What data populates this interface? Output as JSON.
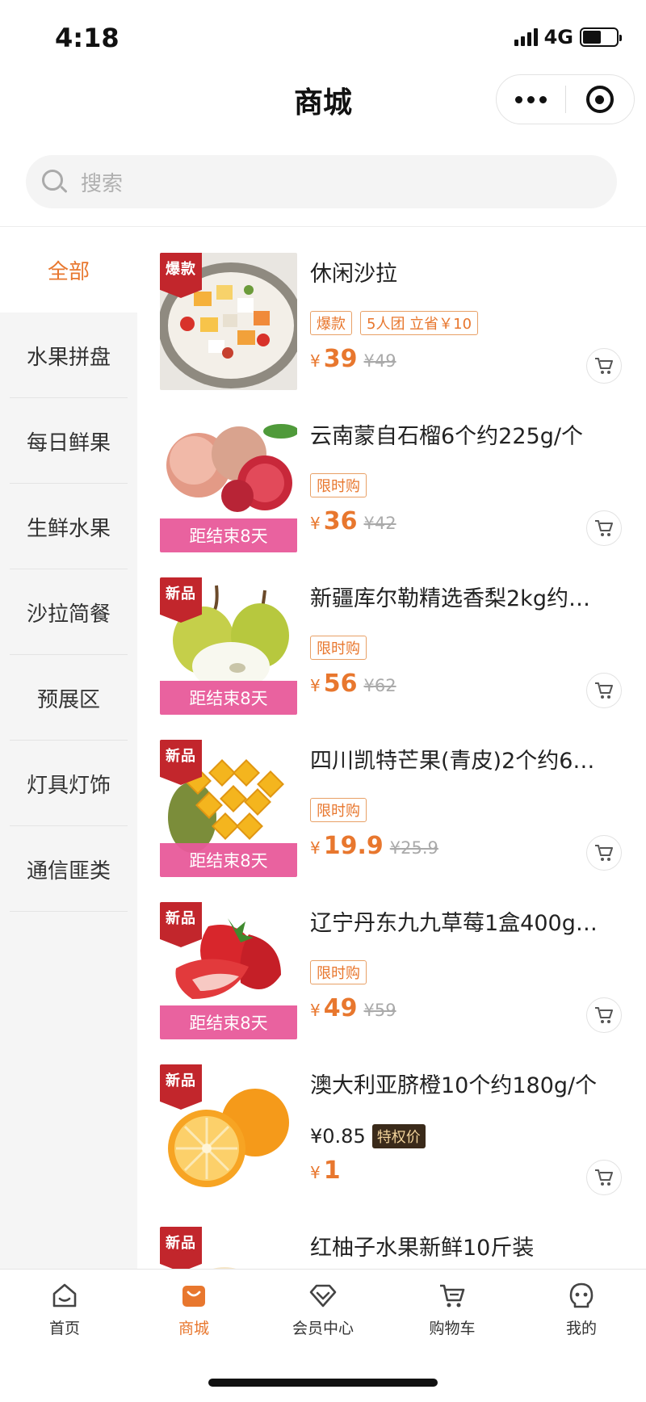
{
  "status_bar": {
    "time": "4:18",
    "network": "4G"
  },
  "header": {
    "title": "商城"
  },
  "search": {
    "placeholder": "搜索"
  },
  "sidebar": {
    "items": [
      {
        "label": "全部",
        "active": true
      },
      {
        "label": "水果拼盘"
      },
      {
        "label": "每日鲜果"
      },
      {
        "label": "生鲜水果"
      },
      {
        "label": "沙拉简餐"
      },
      {
        "label": "预展区"
      },
      {
        "label": "灯具灯饰"
      },
      {
        "label": "通信匪类"
      }
    ]
  },
  "products": [
    {
      "title": "休闲沙拉",
      "corner_tag": "爆款",
      "badges": [
        "爆款",
        "5人团 立省￥10"
      ],
      "yen": "¥",
      "price": "39",
      "original_price": "¥49"
    },
    {
      "title": "云南蒙自石榴6个约225g/个",
      "badges": [
        "限时购"
      ],
      "countdown": "距结束8天",
      "yen": "¥",
      "price": "36",
      "original_price": "¥42"
    },
    {
      "title": "新疆库尔勒精选香梨2kg约…",
      "corner_tag": "新品",
      "badges": [
        "限时购"
      ],
      "countdown": "距结束8天",
      "yen": "¥",
      "price": "56",
      "original_price": "¥62"
    },
    {
      "title": "四川凯特芒果(青皮)2个约6…",
      "corner_tag": "新品",
      "badges": [
        "限时购"
      ],
      "countdown": "距结束8天",
      "yen": "¥",
      "price": "19.9",
      "original_price": "¥25.9"
    },
    {
      "title": "辽宁丹东九九草莓1盒400g…",
      "corner_tag": "新品",
      "badges": [
        "限时购"
      ],
      "countdown": "距结束8天",
      "yen": "¥",
      "price": "49",
      "original_price": "¥59"
    },
    {
      "title": "澳大利亚脐橙10个约180g/个",
      "corner_tag": "新品",
      "vip_price": "¥0.85",
      "vip_tag": "特权价",
      "yen": "¥",
      "price": "1"
    },
    {
      "title": "红柚子水果新鲜10斤装",
      "corner_tag": "新品"
    }
  ],
  "tabbar": {
    "items": [
      {
        "label": "首页"
      },
      {
        "label": "商城",
        "active": true
      },
      {
        "label": "会员中心"
      },
      {
        "label": "购物车"
      },
      {
        "label": "我的"
      }
    ]
  },
  "colors": {
    "accent": "#e8772e",
    "countdown_bg": "#e85a9a",
    "tag_red": "#c2262c"
  }
}
